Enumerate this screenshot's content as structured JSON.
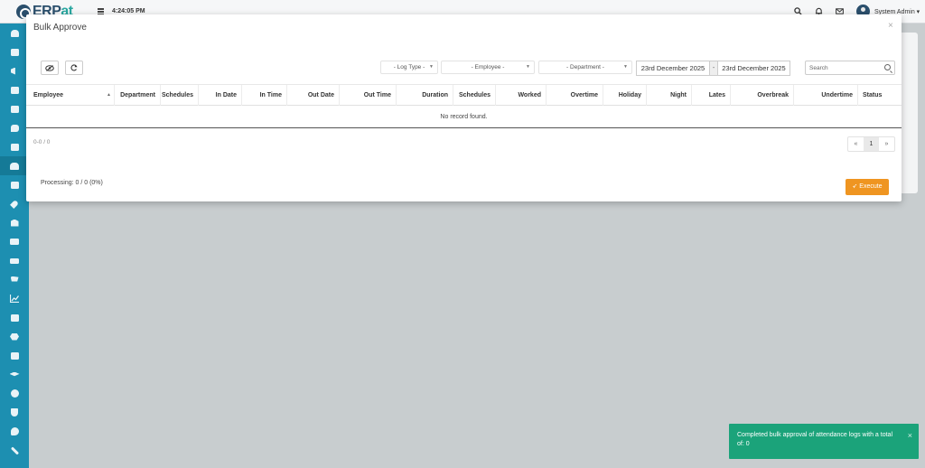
{
  "topbar": {
    "logo_main": "ERP",
    "logo_accent": "at",
    "clock": "4:24:05 PM",
    "user_name": "System Admin ▾"
  },
  "modal": {
    "title": "Bulk Approve",
    "close": "×",
    "filters": {
      "log_type": "- Log Type -",
      "employee": "- Employee -",
      "department": "- Department -",
      "date_from": "23rd December 2025",
      "date_sep": "-",
      "date_to": "23rd December 2025",
      "search_placeholder": "Search"
    },
    "columns": [
      "Employee",
      "Department",
      "Schedules",
      "In Date",
      "In Time",
      "Out Date",
      "Out Time",
      "Duration",
      "Schedules",
      "Worked",
      "Overtime",
      "Holiday",
      "Night",
      "Lates",
      "Overbreak",
      "Undertime",
      "Status"
    ],
    "empty_message": "No record found.",
    "pager_info": "0-0 / 0",
    "pager": {
      "prev": "«",
      "current": "1",
      "next": "»"
    },
    "processing": "Processing: 0 / 0 (0%)",
    "execute_label": "Execute"
  },
  "toast": {
    "message": "Completed bulk approval of attendance logs with a total of: 0",
    "close": "×"
  },
  "colors": {
    "sidebar": "#1d8fb1",
    "execute": "#ef9521",
    "toast": "#1ba37a"
  },
  "sidebar_icons": [
    "dashboard-icon",
    "id-card-icon",
    "megaphone-icon",
    "calendar-icon",
    "checklist-icon",
    "chat-icon",
    "mail-icon",
    "users-icon",
    "briefcase-icon",
    "rocket-icon",
    "bank-icon",
    "money-icon",
    "truck-icon",
    "cart-icon",
    "chart-icon",
    "edit-icon",
    "cubes-icon",
    "list-icon",
    "graduation-icon",
    "lifebuoy-icon",
    "shield-icon",
    "palette-icon",
    "wrench-icon"
  ]
}
